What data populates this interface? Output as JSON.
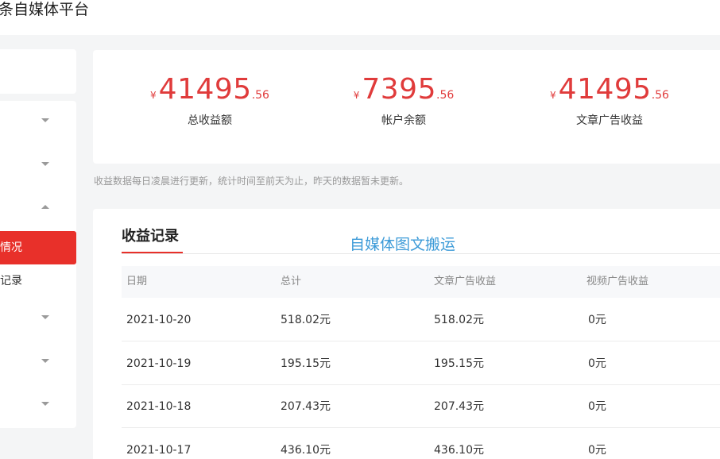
{
  "app": {
    "title": "条自媒体平台"
  },
  "sidebar": {
    "active_item": "情况",
    "sub_item": "记录"
  },
  "stats": [
    {
      "currency": "¥",
      "integer": "41495",
      "decimal": ".56",
      "label": "总收益额"
    },
    {
      "currency": "¥",
      "integer": "7395",
      "decimal": ".56",
      "label": "帐户余额"
    },
    {
      "currency": "¥",
      "integer": "41495",
      "decimal": ".56",
      "label": "文章广告收益"
    }
  ],
  "note": "收益数据每日凌晨进行更新，统计时间至前天为止，昨天的数据暂未更新。",
  "records": {
    "title": "收益记录",
    "watermark": "自媒体图文搬运",
    "columns": [
      "日期",
      "总计",
      "文章广告收益",
      "视频广告收益"
    ],
    "rows": [
      {
        "date": "2021-10-20",
        "total": "518.02元",
        "article": "518.02元",
        "video": "0元"
      },
      {
        "date": "2021-10-19",
        "total": "195.15元",
        "article": "195.15元",
        "video": "0元"
      },
      {
        "date": "2021-10-18",
        "total": "207.43元",
        "article": "207.43元",
        "video": "0元"
      },
      {
        "date": "2021-10-17",
        "total": "436.10元",
        "article": "436.10元",
        "video": "0元"
      }
    ]
  },
  "colors": {
    "accent": "#e8302a",
    "amount": "#e03b3b",
    "watermark": "#3d9bd8"
  }
}
